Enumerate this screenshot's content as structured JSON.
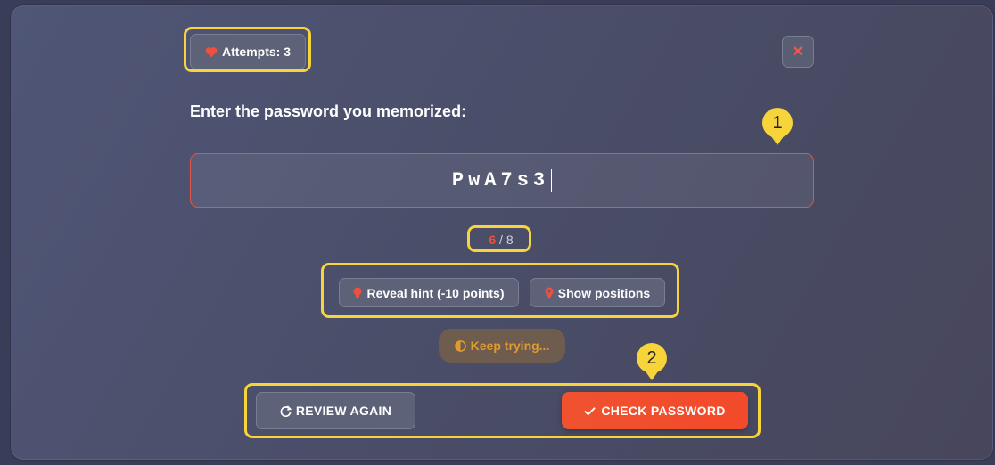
{
  "attempts": {
    "label": "Attempts: 3",
    "icon": "heart-icon",
    "color": "#ef4f3d"
  },
  "close": {
    "label": "✕",
    "icon": "close-icon"
  },
  "prompt": "Enter the password you memorized:",
  "password_field": {
    "value": "PwA7s3"
  },
  "counter": {
    "current": "6",
    "separator": " / ",
    "total": "8"
  },
  "hints": {
    "reveal_label": "Reveal hint (-10 points)",
    "reveal_icon": "lightbulb-icon",
    "positions_label": "Show positions",
    "positions_icon": "map-pin-icon"
  },
  "status": {
    "label": "Keep trying...",
    "icon": "half-circle-icon",
    "color": "#e09a2e"
  },
  "actions": {
    "review_label": "REVIEW AGAIN",
    "review_icon": "refresh-icon",
    "check_label": "CHECK PASSWORD",
    "check_icon": "check-icon"
  },
  "annotations": {
    "marker_1": "1",
    "marker_2": "2"
  },
  "colors": {
    "accent": "#f0522f",
    "highlight": "#f6d43a"
  }
}
